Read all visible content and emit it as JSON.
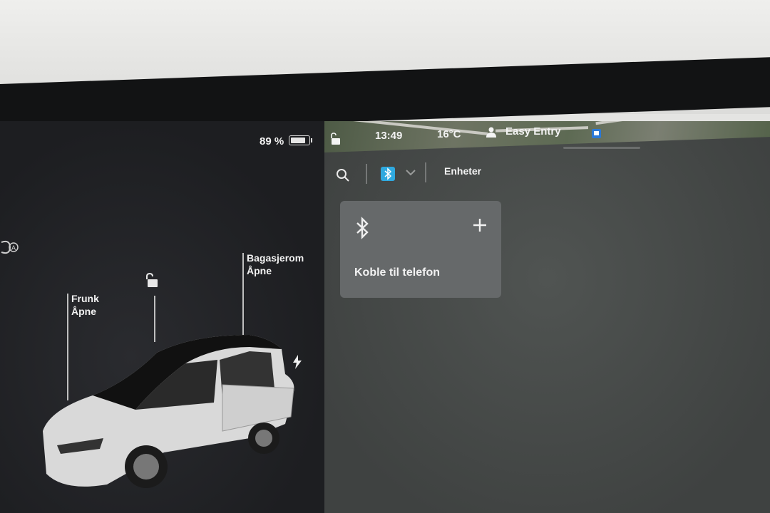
{
  "status_bar": {
    "battery_percent": "89 %",
    "battery_level": 0.89,
    "time": "13:49",
    "temperature": "16°C",
    "profile": "Easy Entry"
  },
  "car_panel": {
    "frunk_label": "Frunk",
    "frunk_action": "Åpne",
    "trunk_label": "Bagasjerom",
    "trunk_action": "Åpne"
  },
  "toolbar": {
    "tab_label": "Enheter"
  },
  "card": {
    "connect_label": "Koble til telefon"
  },
  "colors": {
    "accent": "#2fa9df",
    "card_bg": "#66696a",
    "panel_bg": "#45484a"
  },
  "icons": [
    "battery-icon",
    "lock-open-icon",
    "person-icon",
    "bus-stop-icon",
    "search-icon",
    "bluetooth-icon",
    "chevron-down-icon",
    "plus-icon",
    "headlight-icon",
    "charge-bolt-icon"
  ]
}
